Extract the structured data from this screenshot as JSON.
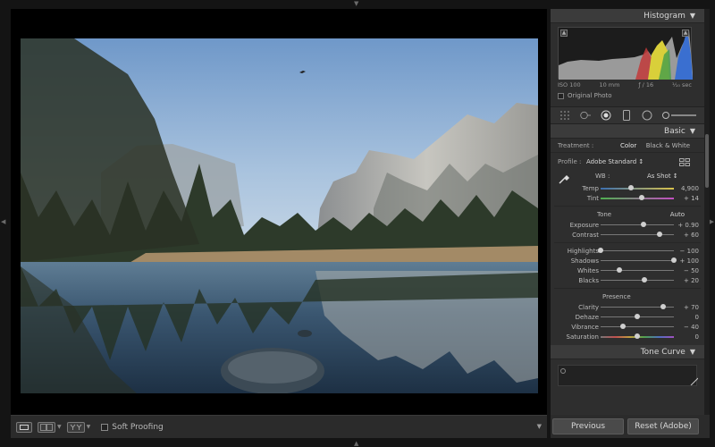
{
  "histogram": {
    "title": "Histogram",
    "exif": {
      "iso": "ISO 100",
      "focal": "10 mm",
      "aperture": "ƒ / 16",
      "shutter": "¹⁄₁₀ sec"
    },
    "original_photo_label": "Original Photo"
  },
  "basic": {
    "title": "Basic",
    "treatment_label": "Treatment :",
    "treatment_color": "Color",
    "treatment_bw": "Black & White",
    "profile_label": "Profile :",
    "profile_value": "Adobe Standard ↕",
    "wb_label": "WB :",
    "wb_value": "As Shot ↕",
    "temp": {
      "label": "Temp",
      "value": "4,900",
      "pos": 0.42
    },
    "tint": {
      "label": "Tint",
      "value": "+ 14",
      "pos": 0.56
    },
    "tone_title": "Tone",
    "tone_auto": "Auto",
    "exposure": {
      "label": "Exposure",
      "value": "+ 0.90",
      "pos": 0.59
    },
    "contrast": {
      "label": "Contrast",
      "value": "+ 60",
      "pos": 0.8
    },
    "highlights": {
      "label": "Highlights",
      "value": "− 100",
      "pos": 0.0
    },
    "shadows": {
      "label": "Shadows",
      "value": "+ 100",
      "pos": 1.0
    },
    "whites": {
      "label": "Whites",
      "value": "− 50",
      "pos": 0.25
    },
    "blacks": {
      "label": "Blacks",
      "value": "+ 20",
      "pos": 0.6
    },
    "presence_title": "Presence",
    "clarity": {
      "label": "Clarity",
      "value": "+ 70",
      "pos": 0.85
    },
    "dehaze": {
      "label": "Dehaze",
      "value": "0",
      "pos": 0.5
    },
    "vibrance": {
      "label": "Vibrance",
      "value": "− 40",
      "pos": 0.3
    },
    "saturation": {
      "label": "Saturation",
      "value": "0",
      "pos": 0.5
    }
  },
  "tone_curve": {
    "title": "Tone Curve"
  },
  "toolbar": {
    "soft_proofing_label": "Soft Proofing"
  },
  "buttons": {
    "previous": "Previous",
    "reset": "Reset (Adobe)"
  },
  "icons": {
    "panel_collapse": "triangle-down-icon",
    "eyedropper": "eyedropper-icon",
    "profile_browser": "grid-icon"
  }
}
